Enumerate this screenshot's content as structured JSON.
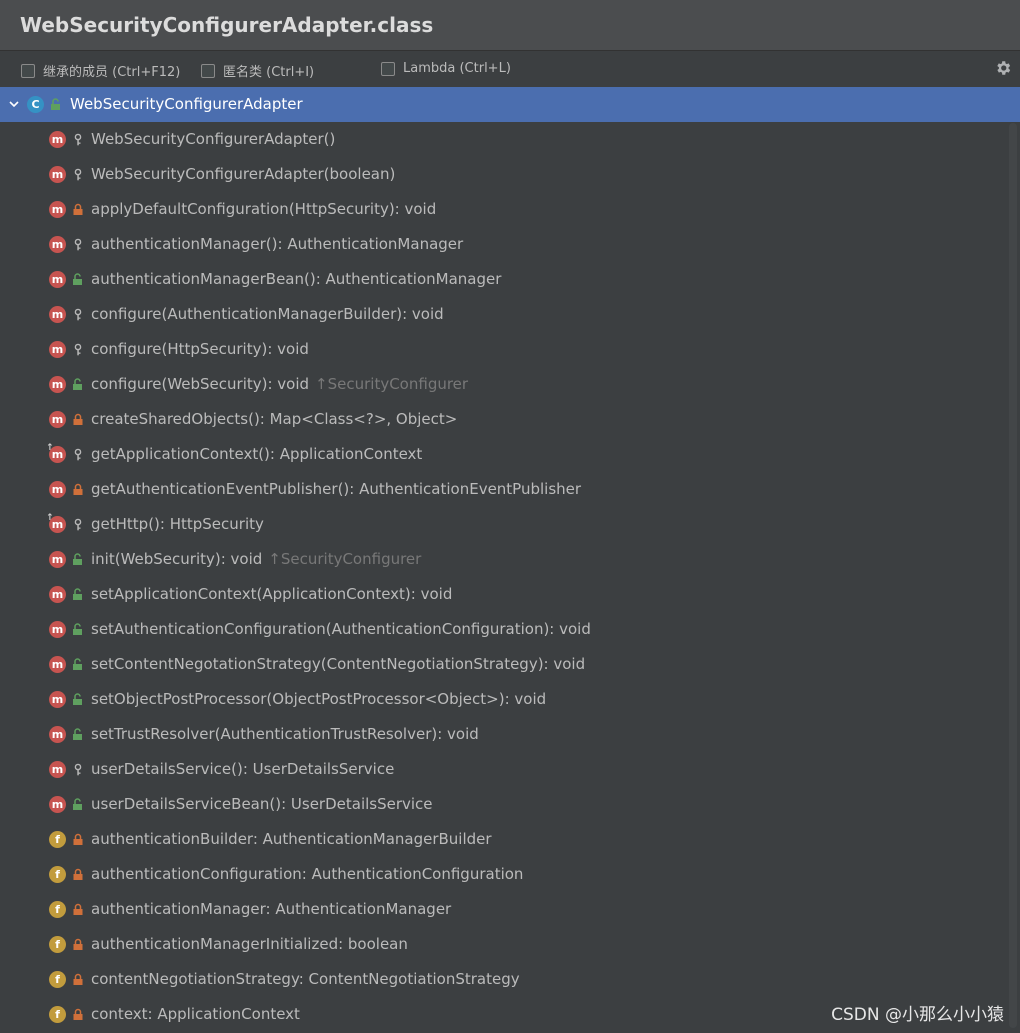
{
  "window": {
    "title": "WebSecurityConfigurerAdapter.class"
  },
  "toolbar": {
    "inherited_label": "继承的成员 (Ctrl+F12)",
    "anonymous_label": "匿名类 (Ctrl+I)",
    "lambda_label": "Lambda (Ctrl+L)"
  },
  "root": {
    "kind_glyph": "C",
    "label": "WebSecurityConfigurerAdapter"
  },
  "members": [
    {
      "kind": "m",
      "vis": "protected",
      "label": "WebSecurityConfigurerAdapter()",
      "hint": ""
    },
    {
      "kind": "m",
      "vis": "protected",
      "label": "WebSecurityConfigurerAdapter(boolean)",
      "hint": ""
    },
    {
      "kind": "m",
      "vis": "private",
      "label": "applyDefaultConfiguration(HttpSecurity): void",
      "hint": ""
    },
    {
      "kind": "m",
      "vis": "protected",
      "label": "authenticationManager(): AuthenticationManager",
      "hint": ""
    },
    {
      "kind": "m",
      "vis": "public",
      "label": "authenticationManagerBean(): AuthenticationManager",
      "hint": ""
    },
    {
      "kind": "m",
      "vis": "protected",
      "label": "configure(AuthenticationManagerBuilder): void",
      "hint": ""
    },
    {
      "kind": "m",
      "vis": "protected",
      "label": "configure(HttpSecurity): void",
      "hint": ""
    },
    {
      "kind": "m",
      "vis": "public",
      "label": "configure(WebSecurity): void",
      "hint": "↑SecurityConfigurer"
    },
    {
      "kind": "m",
      "vis": "private",
      "label": "createSharedObjects(): Map<Class<?>, Object>",
      "hint": ""
    },
    {
      "kind": "m",
      "vis": "protected",
      "override": true,
      "label": "getApplicationContext(): ApplicationContext",
      "hint": ""
    },
    {
      "kind": "m",
      "vis": "private",
      "label": "getAuthenticationEventPublisher(): AuthenticationEventPublisher",
      "hint": ""
    },
    {
      "kind": "m",
      "vis": "protected",
      "override": true,
      "label": "getHttp(): HttpSecurity",
      "hint": ""
    },
    {
      "kind": "m",
      "vis": "public",
      "label": "init(WebSecurity): void",
      "hint": "↑SecurityConfigurer"
    },
    {
      "kind": "m",
      "vis": "public",
      "label": "setApplicationContext(ApplicationContext): void",
      "hint": ""
    },
    {
      "kind": "m",
      "vis": "public",
      "label": "setAuthenticationConfiguration(AuthenticationConfiguration): void",
      "hint": ""
    },
    {
      "kind": "m",
      "vis": "public",
      "label": "setContentNegotationStrategy(ContentNegotiationStrategy): void",
      "hint": ""
    },
    {
      "kind": "m",
      "vis": "public",
      "label": "setObjectPostProcessor(ObjectPostProcessor<Object>): void",
      "hint": ""
    },
    {
      "kind": "m",
      "vis": "public",
      "label": "setTrustResolver(AuthenticationTrustResolver): void",
      "hint": ""
    },
    {
      "kind": "m",
      "vis": "protected",
      "label": "userDetailsService(): UserDetailsService",
      "hint": ""
    },
    {
      "kind": "m",
      "vis": "public",
      "label": "userDetailsServiceBean(): UserDetailsService",
      "hint": ""
    },
    {
      "kind": "f",
      "vis": "private",
      "label": "authenticationBuilder: AuthenticationManagerBuilder",
      "hint": ""
    },
    {
      "kind": "f",
      "vis": "private",
      "label": "authenticationConfiguration: AuthenticationConfiguration",
      "hint": ""
    },
    {
      "kind": "f",
      "vis": "private",
      "label": "authenticationManager: AuthenticationManager",
      "hint": ""
    },
    {
      "kind": "f",
      "vis": "private",
      "label": "authenticationManagerInitialized: boolean",
      "hint": ""
    },
    {
      "kind": "f",
      "vis": "private",
      "label": "contentNegotiationStrategy: ContentNegotiationStrategy",
      "hint": ""
    },
    {
      "kind": "f",
      "vis": "private",
      "label": "context: ApplicationContext",
      "hint": ""
    }
  ],
  "watermark": "CSDN @小那么小小猿",
  "colors": {
    "background": "#3c3f41",
    "selection": "#4b6eaf",
    "method_badge": "#c75450",
    "field_badge": "#c29c3d",
    "class_badge": "#3592c4",
    "public": "#5fa05f",
    "private": "#d0703a",
    "protected": "#b8b8b8"
  }
}
